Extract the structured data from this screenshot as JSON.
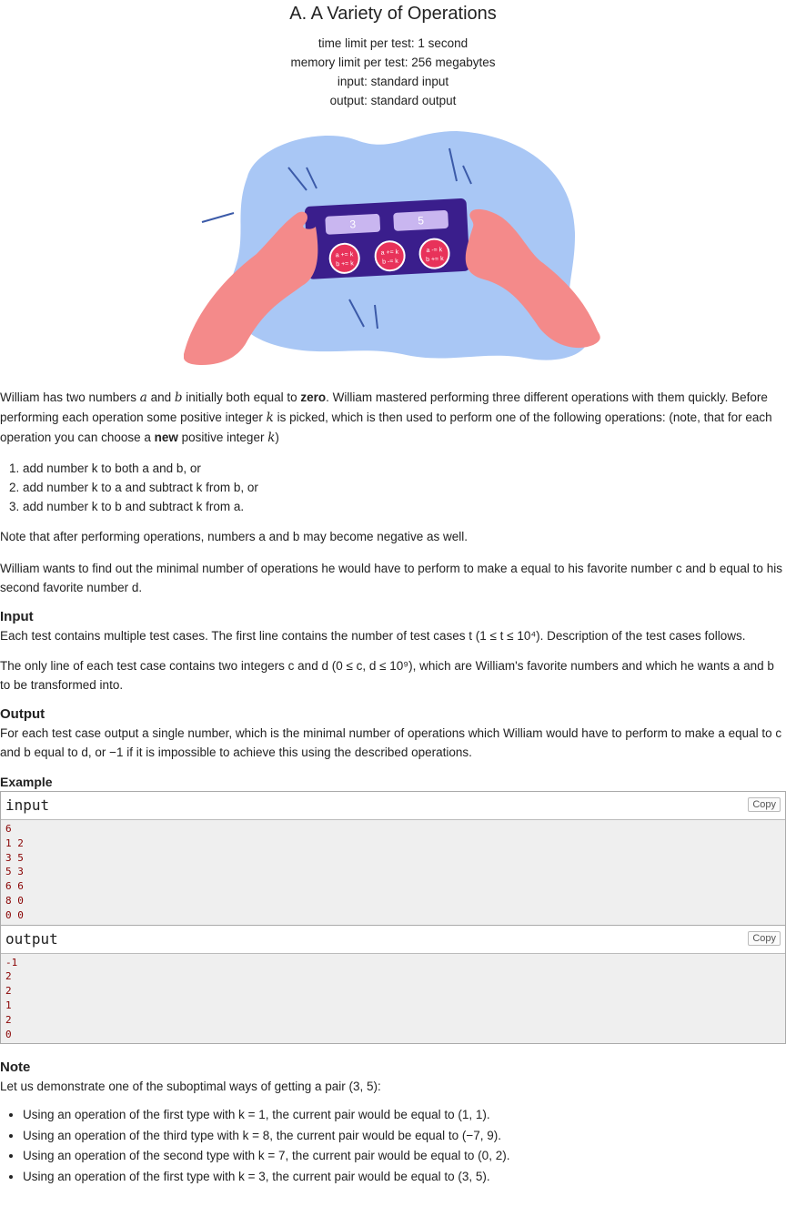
{
  "header": {
    "title": "A. A Variety of Operations",
    "time_limit": "time limit per test: 1 second",
    "memory_limit": "memory limit per test: 256 megabytes",
    "input": "input: standard input",
    "output": "output: standard output"
  },
  "illustration": {
    "screen_left": "3",
    "screen_right": "5",
    "btn1_l1": "a += k",
    "btn1_l2": "b += k",
    "btn2_l1": "a += k",
    "btn2_l2": "b -= k",
    "btn3_l1": "a -= k",
    "btn3_l2": "b += k"
  },
  "statement": {
    "p1_a": "William has two numbers ",
    "p1_b": " and ",
    "p1_c": " initially both equal to ",
    "p1_zero": "zero",
    "p1_d": ". William mastered performing three different operations with them quickly. Before performing each operation some positive integer ",
    "p1_e": " is picked, which is then used to perform one of the following operations: (note, that for each operation you can choose a ",
    "p1_new": "new",
    "p1_f": " positive integer ",
    "p1_g": ")",
    "ops": [
      "add number k to both a and b, or",
      "add number k to a and subtract k from b, or",
      "add number k to b and subtract k from a."
    ],
    "p2": "Note that after performing operations, numbers a and b may become negative as well.",
    "p3": "William wants to find out the minimal number of operations he would have to perform to make a equal to his favorite number c and b equal to his second favorite number d."
  },
  "input_section": {
    "heading": "Input",
    "p1": "Each test contains multiple test cases. The first line contains the number of test cases t (1 ≤ t ≤ 10⁴). Description of the test cases follows.",
    "p2": "The only line of each test case contains two integers c and d (0 ≤ c, d ≤ 10⁹), which are William's favorite numbers and which he wants a and b to be transformed into."
  },
  "output_section": {
    "heading": "Output",
    "p1": "For each test case output a single number, which is the minimal number of operations which William would have to perform to make a equal to c and b equal to d, or −1 if it is impossible to achieve this using the described operations."
  },
  "example": {
    "heading": "Example",
    "input_label": "input",
    "output_label": "output",
    "copy_label": "Copy",
    "input_text": "6\n1 2\n3 5\n5 3\n6 6\n8 0\n0 0",
    "output_text": "-1\n2\n2\n1\n2\n0"
  },
  "note": {
    "heading": "Note",
    "intro": "Let us demonstrate one of the suboptimal ways of getting a pair (3, 5):",
    "items": [
      "Using an operation of the first type with k = 1, the current pair would be equal to (1, 1).",
      "Using an operation of the third type with k = 8, the current pair would be equal to (−7, 9).",
      "Using an operation of the second type with k = 7, the current pair would be equal to (0, 2).",
      "Using an operation of the first type with k = 3, the current pair would be equal to (3, 5)."
    ]
  },
  "colors": {
    "blob": "#a9c7f5",
    "device": "#3a1e8c",
    "device_screen": "#c9b6f0",
    "button": "#e8325a",
    "hand": "#f48a8a"
  }
}
